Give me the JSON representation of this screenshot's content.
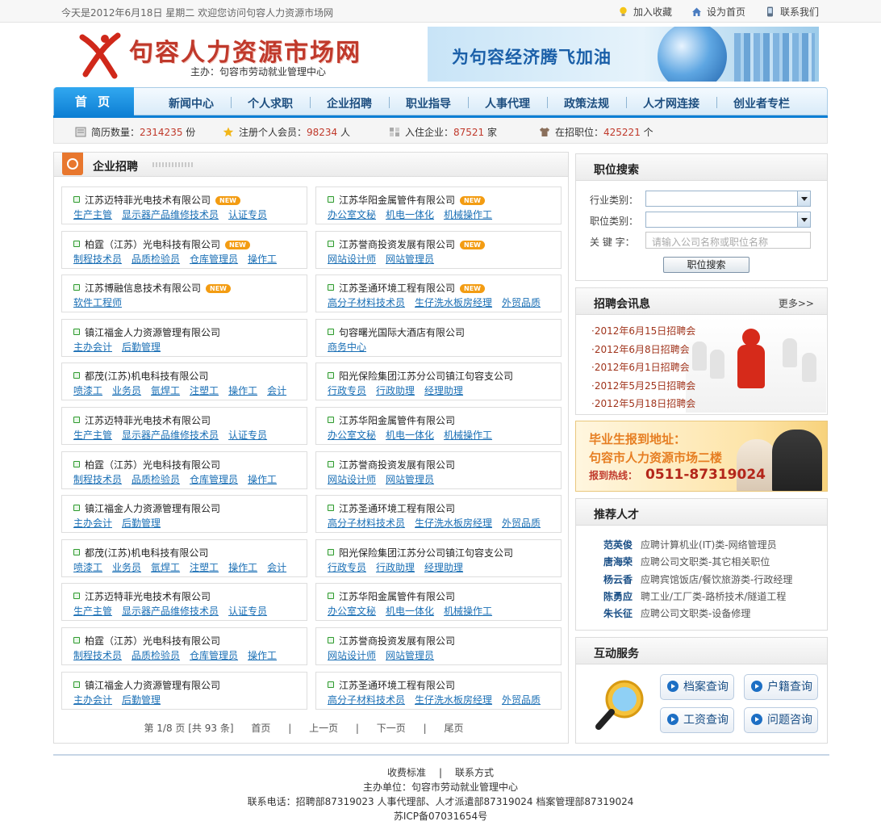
{
  "topbar": {
    "welcome": "今天是2012年6月18日 星期二   欢迎您访问句容人力资源市场网",
    "favorite": "加入收藏",
    "homepage": "设为首页",
    "contact": "联系我们"
  },
  "header": {
    "site_title": "句容人力资源市场网",
    "organizer": "主办：句容市劳动就业管理中心",
    "banner_slogan": "为句容经济腾飞加油"
  },
  "nav": {
    "home": "首 页",
    "items": [
      "新闻中心",
      "个人求职",
      "企业招聘",
      "职业指导",
      "人事代理",
      "政策法规",
      "人才网连接",
      "创业者专栏"
    ]
  },
  "stats": [
    {
      "label": "简历数量：",
      "value": "2314235",
      "unit": "份"
    },
    {
      "label": "注册个人会员：",
      "value": "98234",
      "unit": "人"
    },
    {
      "label": "入住企业：",
      "value": "87521",
      "unit": "家"
    },
    {
      "label": "在招职位：",
      "value": "425221",
      "unit": "个"
    }
  ],
  "recruit": {
    "title": "企业招聘",
    "new_badge": "NEW",
    "rows": [
      [
        {
          "company": "江苏迈特菲光电技术有限公司",
          "new": true,
          "jobs": [
            "生产主管",
            "显示器产品维修技术员",
            "认证专员"
          ]
        },
        {
          "company": "江苏华阳金属管件有限公司",
          "new": true,
          "jobs": [
            "办公室文秘",
            "机电一体化",
            "机械操作工"
          ]
        }
      ],
      [
        {
          "company": "柏霆（江苏）光电科技有限公司",
          "new": true,
          "jobs": [
            "制程技术员",
            "品质检验员",
            "仓库管理员",
            "操作工"
          ]
        },
        {
          "company": "江苏誉商投资发展有限公司",
          "new": true,
          "jobs": [
            "网站设计师",
            "网站管理员"
          ]
        }
      ],
      [
        {
          "company": "江苏博融信息技术有限公司",
          "new": true,
          "jobs": [
            "软件工程师"
          ]
        },
        {
          "company": "江苏圣通环境工程有限公司",
          "new": true,
          "jobs": [
            "高分子材料技术员",
            "生仔洗水板房经理",
            "外贸品质"
          ]
        }
      ],
      [
        {
          "company": "镇江福金人力资源管理有限公司",
          "new": false,
          "jobs": [
            "主办会计",
            "后勤管理"
          ]
        },
        {
          "company": "句容曙光国际大酒店有限公司",
          "new": false,
          "jobs": [
            "商务中心"
          ]
        }
      ],
      [
        {
          "company": "都茂(江苏)机电科技有限公司",
          "new": false,
          "jobs": [
            "喷漆工",
            "业务员",
            "氩焊工",
            "注塑工",
            "操作工",
            "会计"
          ]
        },
        {
          "company": "阳光保险集团江苏分公司镇江句容支公司",
          "new": false,
          "jobs": [
            "行政专员",
            "行政助理",
            "经理助理"
          ]
        }
      ],
      [
        {
          "company": "江苏迈特菲光电技术有限公司",
          "new": false,
          "jobs": [
            "生产主管",
            "显示器产品维修技术员",
            "认证专员"
          ]
        },
        {
          "company": "江苏华阳金属管件有限公司",
          "new": false,
          "jobs": [
            "办公室文秘",
            "机电一体化",
            "机械操作工"
          ]
        }
      ],
      [
        {
          "company": "柏霆（江苏）光电科技有限公司",
          "new": false,
          "jobs": [
            "制程技术员",
            "品质检验员",
            "仓库管理员",
            "操作工"
          ]
        },
        {
          "company": "江苏誉商投资发展有限公司",
          "new": false,
          "jobs": [
            "网站设计师",
            "网站管理员"
          ]
        }
      ],
      [
        {
          "company": "镇江福金人力资源管理有限公司",
          "new": false,
          "jobs": [
            "主办会计",
            "后勤管理"
          ]
        },
        {
          "company": "江苏圣通环境工程有限公司",
          "new": false,
          "jobs": [
            "高分子材料技术员",
            "生仔洗水板房经理",
            "外贸品质"
          ]
        }
      ],
      [
        {
          "company": "都茂(江苏)机电科技有限公司",
          "new": false,
          "jobs": [
            "喷漆工",
            "业务员",
            "氩焊工",
            "注塑工",
            "操作工",
            "会计"
          ]
        },
        {
          "company": "阳光保险集团江苏分公司镇江句容支公司",
          "new": false,
          "jobs": [
            "行政专员",
            "行政助理",
            "经理助理"
          ]
        }
      ],
      [
        {
          "company": "江苏迈特菲光电技术有限公司",
          "new": false,
          "jobs": [
            "生产主管",
            "显示器产品维修技术员",
            "认证专员"
          ]
        },
        {
          "company": "江苏华阳金属管件有限公司",
          "new": false,
          "jobs": [
            "办公室文秘",
            "机电一体化",
            "机械操作工"
          ]
        }
      ],
      [
        {
          "company": "柏霆（江苏）光电科技有限公司",
          "new": false,
          "jobs": [
            "制程技术员",
            "品质检验员",
            "仓库管理员",
            "操作工"
          ]
        },
        {
          "company": "江苏誉商投资发展有限公司",
          "new": false,
          "jobs": [
            "网站设计师",
            "网站管理员"
          ]
        }
      ],
      [
        {
          "company": "镇江福金人力资源管理有限公司",
          "new": false,
          "jobs": [
            "主办会计",
            "后勤管理"
          ]
        },
        {
          "company": "江苏圣通环境工程有限公司",
          "new": false,
          "jobs": [
            "高分子材料技术员",
            "生仔洗水板房经理",
            "外贸品质"
          ]
        }
      ]
    ],
    "pager": {
      "info": "第 1/8 页 [共 93 条]",
      "first": "首页",
      "prev": "上一页",
      "next": "下一页",
      "last": "尾页",
      "sep": "|"
    }
  },
  "search": {
    "title": "职位搜索",
    "industry_label": "行业类别：",
    "position_label": "职位类别：",
    "keyword_label": "关 键 字：",
    "keyword_placeholder": "请输入公司名称或职位名称",
    "button": "职位搜索"
  },
  "fairs": {
    "title": "招聘会讯息",
    "more": "更多>>",
    "items": [
      "·2012年6月15日招聘会",
      "·2012年6月8日招聘会",
      "·2012年6月1日招聘会",
      "·2012年5月25日招聘会",
      "·2012年5月18日招聘会"
    ]
  },
  "ad": {
    "line1": "毕业生报到地址：",
    "line2": "句容市人力资源市场二楼",
    "hotline_label": "报到热线：",
    "hotline": "0511-87319024"
  },
  "talent": {
    "title": "推荐人才",
    "items": [
      {
        "name": "范英俊",
        "desc": "应聘计算机业(IT)类-网络管理员"
      },
      {
        "name": "唐海荣",
        "desc": "应聘公司文职类-其它相关职位"
      },
      {
        "name": "杨云香",
        "desc": "应聘宾馆饭店/餐饮旅游类-行政经理"
      },
      {
        "name": "陈勇应",
        "desc": "聘工业/工厂类-路桥技术/隧道工程"
      },
      {
        "name": "朱长征",
        "desc": "应聘公司文职类-设备修理"
      }
    ]
  },
  "services": {
    "title": "互动服务",
    "buttons": [
      "档案查询",
      "户籍查询",
      "工资查询",
      "问题咨询"
    ]
  },
  "footer": {
    "fees": "收费标准",
    "contact": "联系方式",
    "sep": "|",
    "organizer": "主办单位：句容市劳动就业管理中心",
    "phones": "联系电话：招聘部87319023  人事代理部、人才派遣部87319024  档案管理部87319024",
    "icp": "苏ICP备07031654号"
  }
}
